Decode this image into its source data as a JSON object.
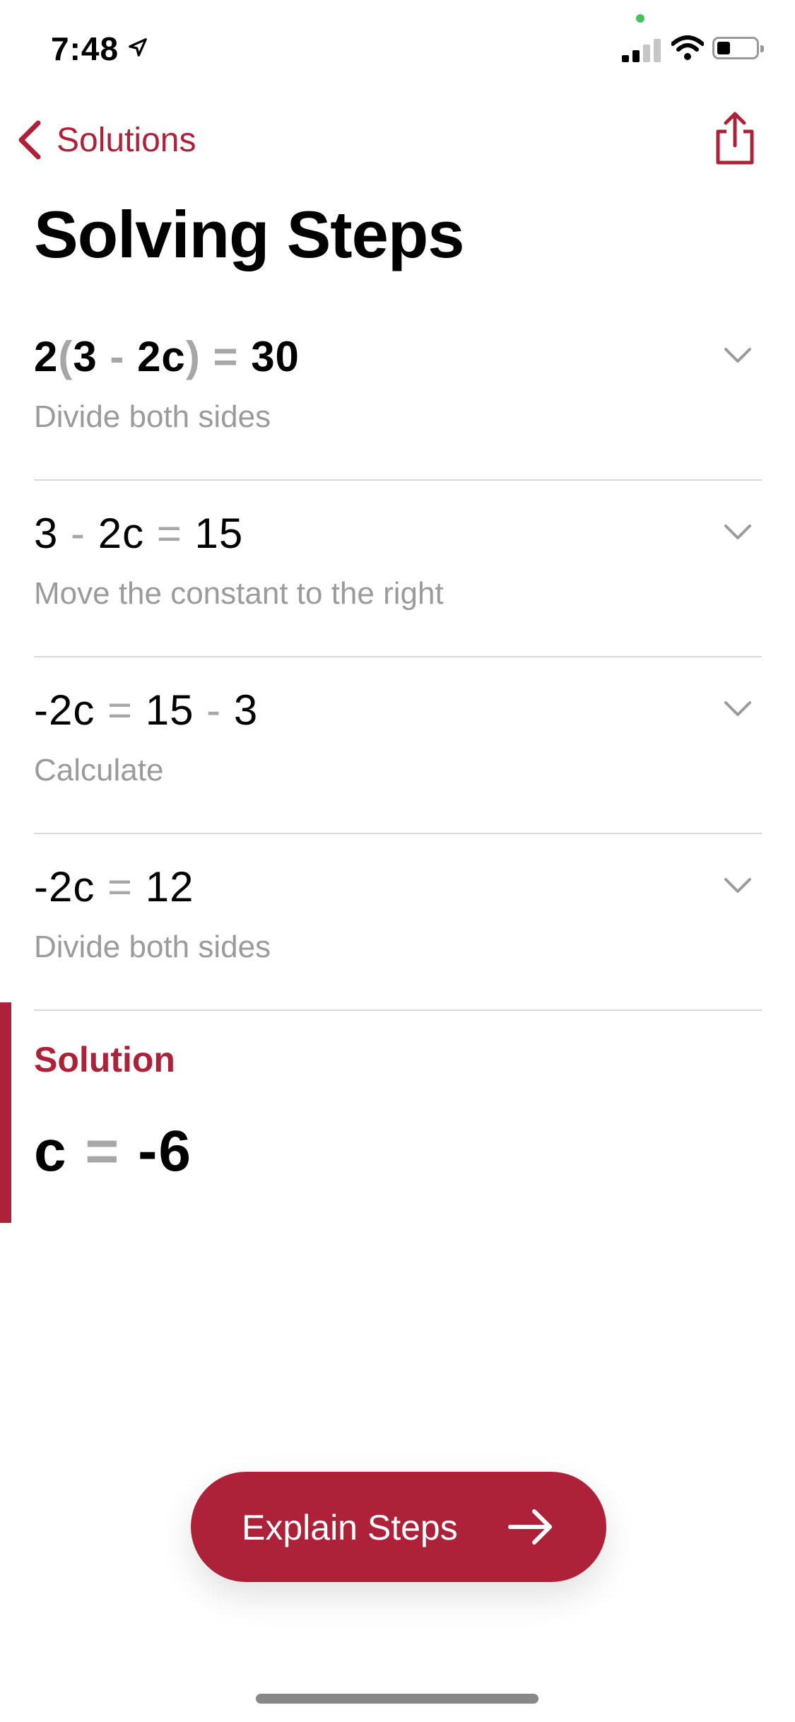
{
  "status_bar": {
    "time": "7:48"
  },
  "nav": {
    "back_label": "Solutions"
  },
  "page_title": "Solving Steps",
  "steps": [
    {
      "parts": [
        {
          "t": "2"
        },
        {
          "t": "(",
          "op": true
        },
        {
          "t": "3"
        },
        {
          "t": " - ",
          "op": true
        },
        {
          "t": "2c"
        },
        {
          "t": ")",
          "op": true
        },
        {
          "t": " = ",
          "op": true
        },
        {
          "t": "30"
        }
      ],
      "description": "Divide both sides"
    },
    {
      "parts": [
        {
          "t": "3"
        },
        {
          "t": " - ",
          "op": true
        },
        {
          "t": "2c"
        },
        {
          "t": " = ",
          "op": true
        },
        {
          "t": "15"
        }
      ],
      "description": "Move the constant to the right"
    },
    {
      "parts": [
        {
          "t": "-2c"
        },
        {
          "t": " = ",
          "op": true
        },
        {
          "t": "15"
        },
        {
          "t": " - ",
          "op": true
        },
        {
          "t": "3"
        }
      ],
      "description": "Calculate"
    },
    {
      "parts": [
        {
          "t": "-2c"
        },
        {
          "t": " = ",
          "op": true
        },
        {
          "t": "12"
        }
      ],
      "description": "Divide both sides"
    }
  ],
  "solution": {
    "label": "Solution",
    "variable": "c",
    "equals": " = ",
    "value": "-6"
  },
  "explain_button": {
    "label": "Explain Steps"
  },
  "colors": {
    "accent": "#ad2239",
    "muted": "#9b9b9b",
    "operator": "#a7a7a7"
  },
  "icons": [
    "location-arrow-icon",
    "signal-icon",
    "wifi-icon",
    "battery-icon",
    "back-chevron-icon",
    "share-icon",
    "chevron-down-icon",
    "arrow-right-icon"
  ]
}
